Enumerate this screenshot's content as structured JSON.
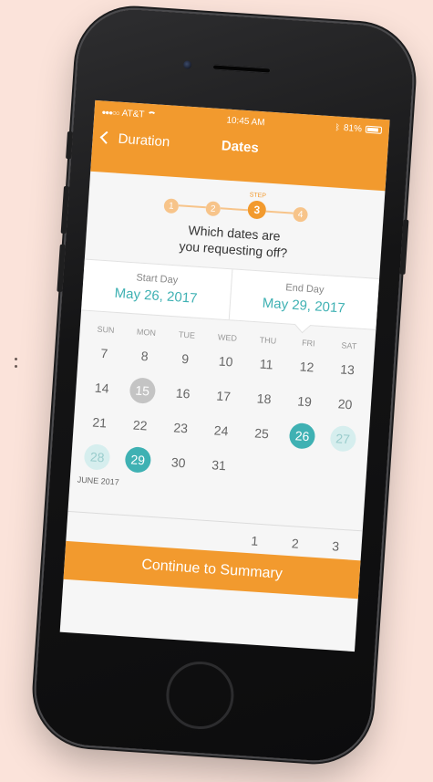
{
  "status_bar": {
    "carrier": "AT&T",
    "time": "10:45 AM",
    "battery": "81%"
  },
  "nav": {
    "back_label": "Duration",
    "title": "Dates"
  },
  "stepper": {
    "caption": "STEP",
    "steps": [
      "1",
      "2",
      "3",
      "4"
    ],
    "current": 3
  },
  "question": {
    "line1": "Which dates are",
    "line2": "you requesting off?"
  },
  "start": {
    "label": "Start Day",
    "value": "May 26, 2017"
  },
  "end": {
    "label": "End Day",
    "value": "May 29, 2017"
  },
  "weekdays": [
    "SUN",
    "MON",
    "TUE",
    "WED",
    "THU",
    "FRI",
    "SAT"
  ],
  "may_days": [
    "7",
    "8",
    "9",
    "10",
    "11",
    "12",
    "13",
    "14",
    "15",
    "16",
    "17",
    "18",
    "19",
    "20",
    "21",
    "22",
    "23",
    "24",
    "25",
    "26",
    "27",
    "28",
    "29",
    "30",
    "31"
  ],
  "next_month_label": "JUNE 2017",
  "june_days": [
    "",
    "",
    "",
    "",
    "1",
    "2",
    "3"
  ],
  "cta_label": "Continue to Summary",
  "colors": {
    "accent": "#f29a2e",
    "selected": "#3fb1b3",
    "range": "#d6eeee",
    "today": "#c4c4c4"
  }
}
